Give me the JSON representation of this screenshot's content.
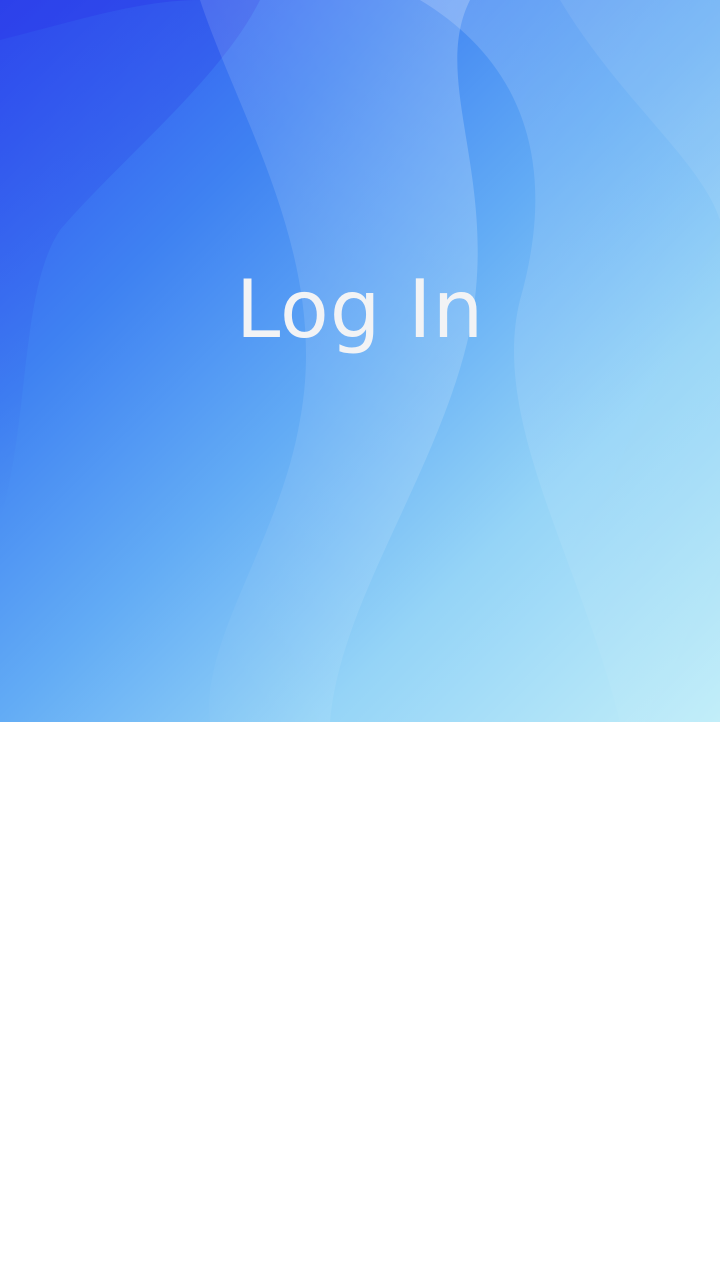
{
  "header": {
    "title": "Log In"
  },
  "colors": {
    "gradient_start": "#2f4df0",
    "gradient_mid": "#63acf5",
    "gradient_end": "#c2eef9",
    "title_text": "#f2f3f5",
    "background": "#ffffff"
  }
}
